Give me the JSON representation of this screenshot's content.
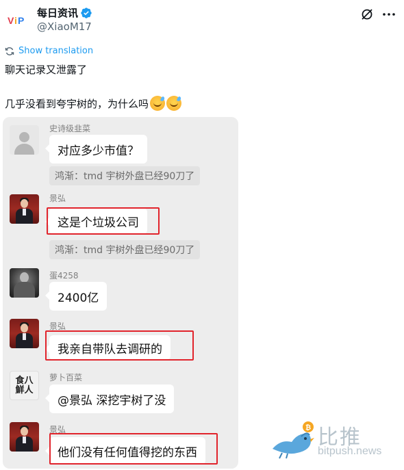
{
  "post": {
    "author_name": "每日资讯",
    "handle": "@XiaoM17",
    "avatar_logo_text": "VIP",
    "translation_label": "Show translation",
    "text_line1": "聊天记录又泄露了",
    "text_line2": "几乎没看到夸宇树的，为什么吗"
  },
  "chat": {
    "messages": [
      {
        "sender": "史诗级韭菜",
        "avatar": "gray-person-icon",
        "text": "对应多少市值？",
        "quote": "鸿渐：tmd 宇树外盘已经90刀了"
      },
      {
        "sender": "景弘",
        "avatar": "man-suit-avatar",
        "text": "这是个垃圾公司",
        "quote": "鸿渐：tmd 宇树外盘已经90刀了",
        "highlighted": true
      },
      {
        "sender": "蛋4258",
        "avatar": "dark-figure-avatar",
        "text": "2400亿"
      },
      {
        "sender": "景弘",
        "avatar": "man-suit-avatar",
        "text": "我亲自带队去调研的",
        "highlighted": true
      },
      {
        "sender": "萝卜百菜",
        "avatar": "calligraphy-logo-avatar",
        "avatar_text": "食八\n鮮人",
        "text": "@景弘  深挖宇树了没"
      },
      {
        "sender": "景弘",
        "avatar": "man-suit-avatar",
        "text": "他们没有任何值得挖的东西",
        "highlighted": true
      }
    ]
  },
  "watermark": {
    "cn": "比推",
    "en": "bitpush.news"
  },
  "colors": {
    "link": "#1d9bf0",
    "verified": "#1d9bf0",
    "highlight_box": "#e1232b",
    "chat_bg": "#ededed"
  }
}
